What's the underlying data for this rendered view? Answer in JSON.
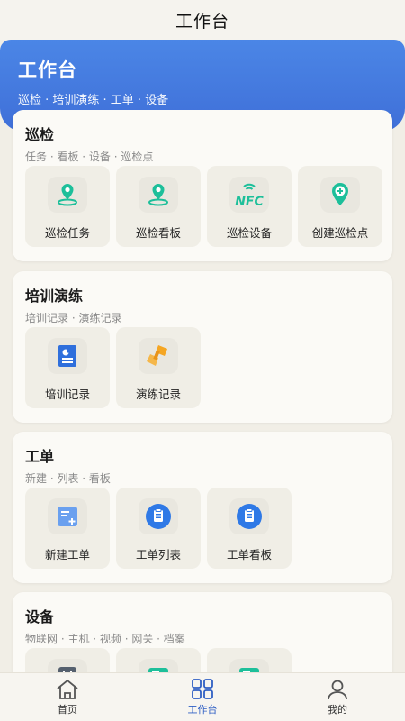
{
  "topbar": {
    "title": "工作台"
  },
  "hero": {
    "title": "工作台",
    "subtitle": "巡检 · 培训演练 · 工单 · 设备"
  },
  "sections": [
    {
      "title": "巡检",
      "subtitle": "任务 · 看板 · 设备 · 巡检点",
      "items": [
        {
          "label": "巡检任务",
          "icon": "patrol-task-icon"
        },
        {
          "label": "巡检看板",
          "icon": "patrol-board-icon"
        },
        {
          "label": "巡检设备",
          "icon": "nfc-icon",
          "icon_text": "NFC"
        },
        {
          "label": "创建巡检点",
          "icon": "add-location-icon"
        }
      ]
    },
    {
      "title": "培训演练",
      "subtitle": "培训记录 · 演练记录",
      "items": [
        {
          "label": "培训记录",
          "icon": "training-record-icon"
        },
        {
          "label": "演练记录",
          "icon": "drill-record-icon"
        }
      ]
    },
    {
      "title": "工单",
      "subtitle": "新建 · 列表 · 看板",
      "items": [
        {
          "label": "新建工单",
          "icon": "new-order-icon"
        },
        {
          "label": "工单列表",
          "icon": "order-list-icon"
        },
        {
          "label": "工单看板",
          "icon": "order-board-icon"
        }
      ]
    },
    {
      "title": "设备",
      "subtitle": "物联网 · 主机 · 视频 · 网关 · 档案",
      "items": [
        {
          "label": "",
          "icon": "iot-device-icon"
        },
        {
          "label": "",
          "icon": "host-device-icon"
        },
        {
          "label": "",
          "icon": "video-device-icon"
        }
      ]
    }
  ],
  "tabbar": {
    "tabs": [
      {
        "label": "首页",
        "icon": "home-icon"
      },
      {
        "label": "工作台",
        "icon": "grid-icon",
        "active": true
      },
      {
        "label": "我的",
        "icon": "user-icon"
      }
    ]
  },
  "colors": {
    "accent": "#3f6fd8",
    "teal": "#1dbf9a",
    "blue": "#2f79e6",
    "orange": "#f5a623"
  }
}
